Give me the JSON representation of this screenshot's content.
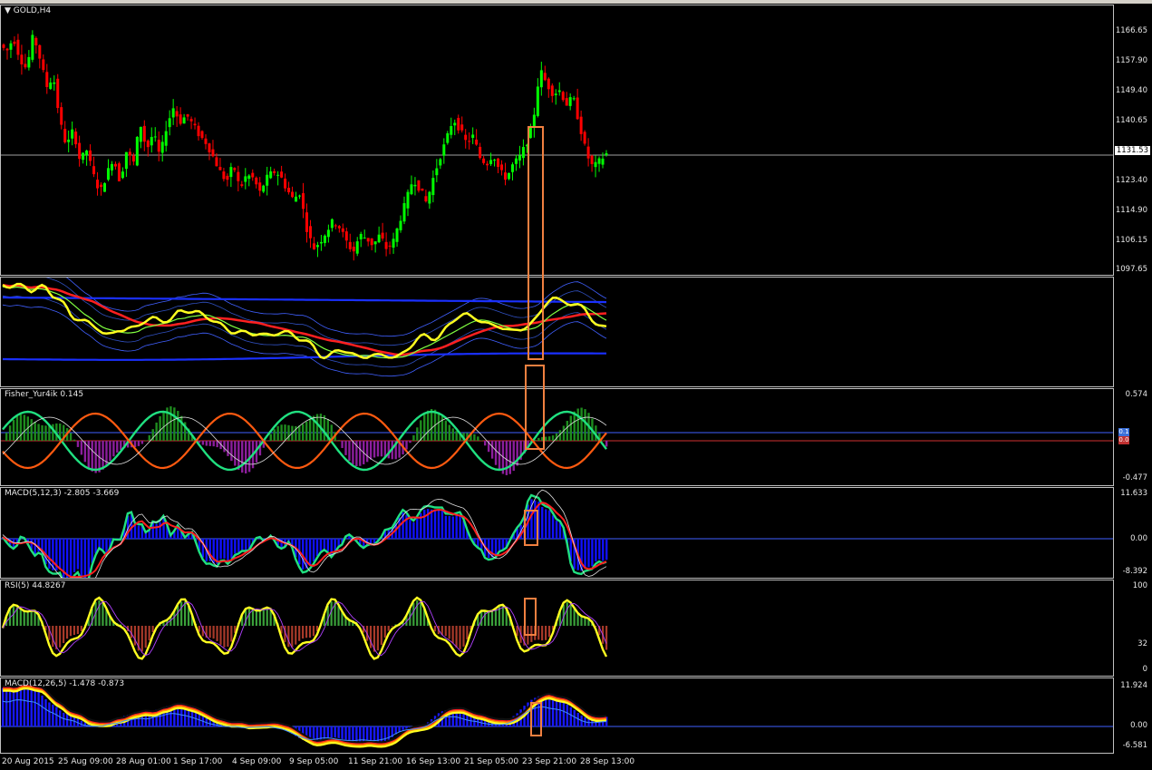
{
  "title": "GOLD,H4",
  "current_price": "1131.53",
  "colors": {
    "bull": "#00ff00",
    "bear": "#ff0000",
    "highlight": "#f08040",
    "grid": "#c0c0c0"
  },
  "main_axis": [
    "1166.65",
    "1157.90",
    "1149.40",
    "1140.65",
    "1131.53",
    "1123.40",
    "1114.90",
    "1106.15",
    "1097.65"
  ],
  "panels": {
    "fisher": {
      "title": "Fisher_Yur4ik 0.145",
      "top": "0.574",
      "bottom": "-0.477",
      "badge_top": "0.1",
      "badge_bottom": "0.0"
    },
    "macd": {
      "title": "MACD(5,12,3) -2.805 -3.669",
      "top": "11.633",
      "mid": "0.00",
      "bottom": "-8.392"
    },
    "rsi": {
      "title": "RSI(5) 44.8267",
      "top": "100",
      "mid": "32",
      "bottom": "0"
    },
    "macd2": {
      "title": "MACD(12,26,5) -1.478 -0.873",
      "top": "11.924",
      "mid": "0.00",
      "bottom": "-6.581"
    }
  },
  "dates": [
    "20 Aug 2015",
    "25 Aug 09:00",
    "28 Aug 01:00",
    "1 Sep 17:00",
    "4 Sep 09:00",
    "9 Sep 05:00",
    "11 Sep 21:00",
    "16 Sep 13:00",
    "21 Sep 05:00",
    "23 Sep 21:00",
    "28 Sep 13:00"
  ],
  "price_series": [
    1162,
    1160,
    1164,
    1158,
    1155,
    1165,
    1158,
    1150,
    1153,
    1140,
    1133,
    1138,
    1129,
    1132,
    1125,
    1120,
    1125,
    1130,
    1123,
    1132,
    1128,
    1140,
    1132,
    1137,
    1130,
    1139,
    1144,
    1140,
    1142,
    1139,
    1136,
    1134,
    1130,
    1126,
    1123,
    1128,
    1121,
    1125,
    1124,
    1120,
    1124,
    1126,
    1125,
    1121,
    1118,
    1120,
    1110,
    1104,
    1106,
    1109,
    1112,
    1110,
    1106,
    1103,
    1108,
    1107,
    1105,
    1108,
    1104,
    1106,
    1112,
    1118,
    1124,
    1121,
    1117,
    1124,
    1130,
    1135,
    1141,
    1138,
    1134,
    1136,
    1130,
    1128,
    1131,
    1126,
    1124,
    1128,
    1130,
    1134,
    1140,
    1155,
    1151,
    1148,
    1149,
    1145,
    1147,
    1139,
    1131,
    1127,
    1129,
    1131
  ]
}
